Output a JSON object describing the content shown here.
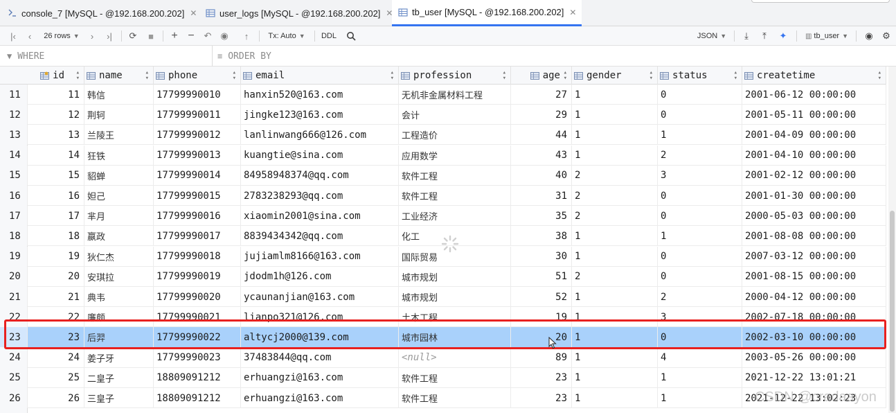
{
  "tabs": [
    {
      "label": "console_7 [MySQL - @192.168.200.202]",
      "active": false,
      "icon": "console-icon"
    },
    {
      "label": "user_logs [MySQL - @192.168.200.202]",
      "active": false,
      "icon": "table-icon"
    },
    {
      "label": "tb_user [MySQL - @192.168.200.202]",
      "active": true,
      "icon": "table-icon"
    }
  ],
  "toolbar": {
    "rows_label": "26 rows",
    "tx_label": "Tx: Auto",
    "ddl_label": "DDL",
    "json_label": "JSON",
    "table_label": "tb_user"
  },
  "filter": {
    "where_placeholder": "WHERE",
    "orderby_placeholder": "ORDER BY"
  },
  "grid": {
    "columns": [
      "id",
      "name",
      "phone",
      "email",
      "profession",
      "age",
      "gender",
      "status",
      "createtime"
    ],
    "rows": [
      {
        "rownum": "11",
        "id": "11",
        "name": "韩信",
        "phone": "17799990010",
        "email": "hanxin520@163.com",
        "profession": "无机非金属材料工程",
        "age": "27",
        "gender": "1",
        "status": "0",
        "createtime": "2001-06-12 00:00:00"
      },
      {
        "rownum": "12",
        "id": "12",
        "name": "荆轲",
        "phone": "17799990011",
        "email": "jingke123@163.com",
        "profession": "会计",
        "age": "29",
        "gender": "1",
        "status": "0",
        "createtime": "2001-05-11 00:00:00"
      },
      {
        "rownum": "13",
        "id": "13",
        "name": "兰陵王",
        "phone": "17799990012",
        "email": "lanlinwang666@126.com",
        "profession": "工程造价",
        "age": "44",
        "gender": "1",
        "status": "1",
        "createtime": "2001-04-09 00:00:00"
      },
      {
        "rownum": "14",
        "id": "14",
        "name": "狂铁",
        "phone": "17799990013",
        "email": "kuangtie@sina.com",
        "profession": "应用数学",
        "age": "43",
        "gender": "1",
        "status": "2",
        "createtime": "2001-04-10 00:00:00"
      },
      {
        "rownum": "15",
        "id": "15",
        "name": "貂蝉",
        "phone": "17799990014",
        "email": "84958948374@qq.com",
        "profession": "软件工程",
        "age": "40",
        "gender": "2",
        "status": "3",
        "createtime": "2001-02-12 00:00:00"
      },
      {
        "rownum": "16",
        "id": "16",
        "name": "妲己",
        "phone": "17799990015",
        "email": "2783238293@qq.com",
        "profession": "软件工程",
        "age": "31",
        "gender": "2",
        "status": "0",
        "createtime": "2001-01-30 00:00:00"
      },
      {
        "rownum": "17",
        "id": "17",
        "name": "芈月",
        "phone": "17799990016",
        "email": "xiaomin2001@sina.com",
        "profession": "工业经济",
        "age": "35",
        "gender": "2",
        "status": "0",
        "createtime": "2000-05-03 00:00:00"
      },
      {
        "rownum": "18",
        "id": "18",
        "name": "嬴政",
        "phone": "17799990017",
        "email": "8839434342@qq.com",
        "profession": "化工",
        "age": "38",
        "gender": "1",
        "status": "1",
        "createtime": "2001-08-08 00:00:00"
      },
      {
        "rownum": "19",
        "id": "19",
        "name": "狄仁杰",
        "phone": "17799990018",
        "email": "jujiamlm8166@163.com",
        "profession": "国际贸易",
        "age": "30",
        "gender": "1",
        "status": "0",
        "createtime": "2007-03-12 00:00:00"
      },
      {
        "rownum": "20",
        "id": "20",
        "name": "安琪拉",
        "phone": "17799990019",
        "email": "jdodm1h@126.com",
        "profession": "城市规划",
        "age": "51",
        "gender": "2",
        "status": "0",
        "createtime": "2001-08-15 00:00:00"
      },
      {
        "rownum": "21",
        "id": "21",
        "name": "典韦",
        "phone": "17799990020",
        "email": "ycaunanjian@163.com",
        "profession": "城市规划",
        "age": "52",
        "gender": "1",
        "status": "2",
        "createtime": "2000-04-12 00:00:00"
      },
      {
        "rownum": "22",
        "id": "22",
        "name": "廉颇",
        "phone": "17799990021",
        "email": "lianpo321@126.com",
        "profession": "土木工程",
        "age": "19",
        "gender": "1",
        "status": "3",
        "createtime": "2002-07-18 00:00:00"
      },
      {
        "rownum": "23",
        "id": "23",
        "name": "后羿",
        "phone": "17799990022",
        "email": "altycj2000@139.com",
        "profession": "城市园林",
        "age": "20",
        "gender": "1",
        "status": "0",
        "createtime": "2002-03-10 00:00:00"
      },
      {
        "rownum": "24",
        "id": "24",
        "name": "姜子牙",
        "phone": "17799990023",
        "email": "37483844@qq.com",
        "profession": "<null>",
        "age": "89",
        "gender": "1",
        "status": "4",
        "createtime": "2003-05-26 00:00:00"
      },
      {
        "rownum": "25",
        "id": "25",
        "name": "二皇子",
        "phone": "18809091212",
        "email": "erhuangzi@163.com",
        "profession": "软件工程",
        "age": "23",
        "gender": "1",
        "status": "1",
        "createtime": "2021-12-22 13:01:21"
      },
      {
        "rownum": "26",
        "id": "26",
        "name": "三皇子",
        "phone": "18809091212",
        "email": "erhuangzi@163.com",
        "profession": "软件工程",
        "age": "23",
        "gender": "1",
        "status": "1",
        "createtime": "2021-12-22 13:02:23"
      }
    ]
  },
  "watermark": "CSDN @cradaayon",
  "colors": {
    "selection": "#a9d1fb",
    "highlight_border": "#e8201f",
    "active_tab": "#3574f0"
  }
}
